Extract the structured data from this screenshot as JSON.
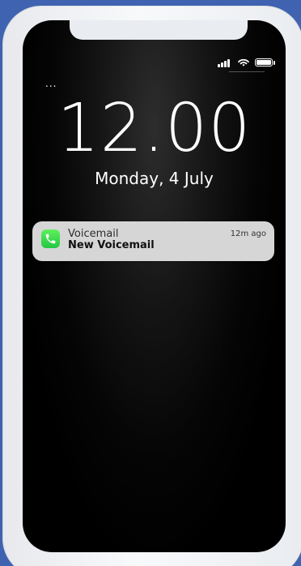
{
  "lock_screen": {
    "time": "12.00",
    "date": "Monday, 4 July",
    "status_bar_icons": [
      "signal-icon",
      "wifi-icon",
      "battery-icon"
    ],
    "menu_indicator": "..."
  },
  "notification": {
    "app_name": "Voicemail",
    "title": "New Voicemail",
    "time_ago": "12m ago",
    "icon": "phone-icon",
    "icon_color": "#34c759"
  },
  "colors": {
    "background": "#3f63b1",
    "device_frame": "#f0f2f5",
    "screen": "#000000",
    "card": "#d6d6d6"
  }
}
